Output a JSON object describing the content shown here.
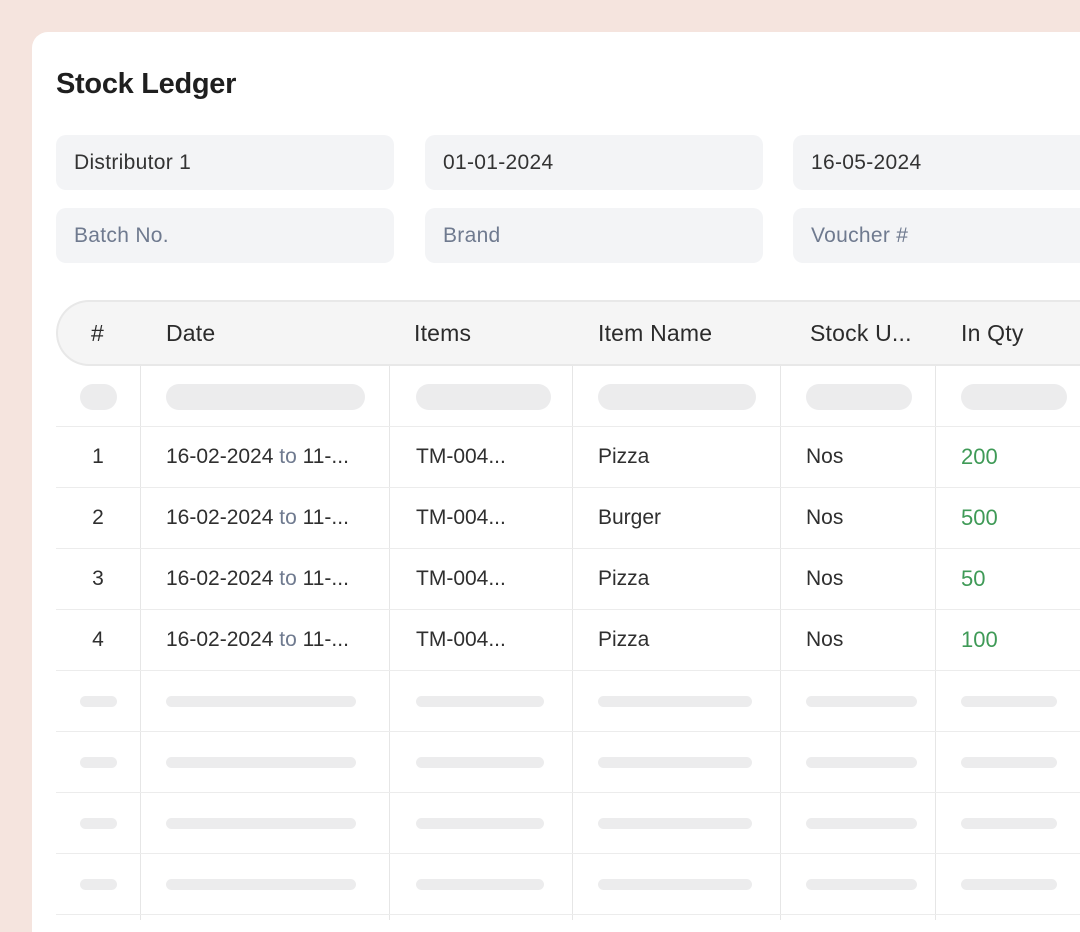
{
  "page": {
    "title": "Stock Ledger"
  },
  "filters": {
    "distributor": "Distributor 1",
    "from_date": "01-01-2024",
    "to_date": "16-05-2024",
    "batch_placeholder": "Batch No.",
    "brand_placeholder": "Brand",
    "voucher_placeholder": "Voucher #"
  },
  "table": {
    "headers": [
      "#",
      "Date",
      "Items",
      "Item Name",
      "Stock U...",
      "In Qty"
    ],
    "rows": [
      {
        "index": "1",
        "date_from": "16-02-2024",
        "to": "to",
        "date_to": "11-...",
        "item": "TM-004...",
        "name": "Pizza",
        "unit": "Nos",
        "in_qty": "200"
      },
      {
        "index": "2",
        "date_from": "16-02-2024",
        "to": "to",
        "date_to": "11-...",
        "item": "TM-004...",
        "name": "Burger",
        "unit": "Nos",
        "in_qty": "500"
      },
      {
        "index": "3",
        "date_from": "16-02-2024",
        "to": "to",
        "date_to": "11-...",
        "item": "TM-004...",
        "name": "Pizza",
        "unit": "Nos",
        "in_qty": "50"
      },
      {
        "index": "4",
        "date_from": "16-02-2024",
        "to": "to",
        "date_to": "11-...",
        "item": "TM-004...",
        "name": "Pizza",
        "unit": "Nos",
        "in_qty": "100"
      }
    ]
  },
  "colors": {
    "background": "#f5e4de",
    "qty": "#3f9a57",
    "muted": "#6f7a8f"
  }
}
